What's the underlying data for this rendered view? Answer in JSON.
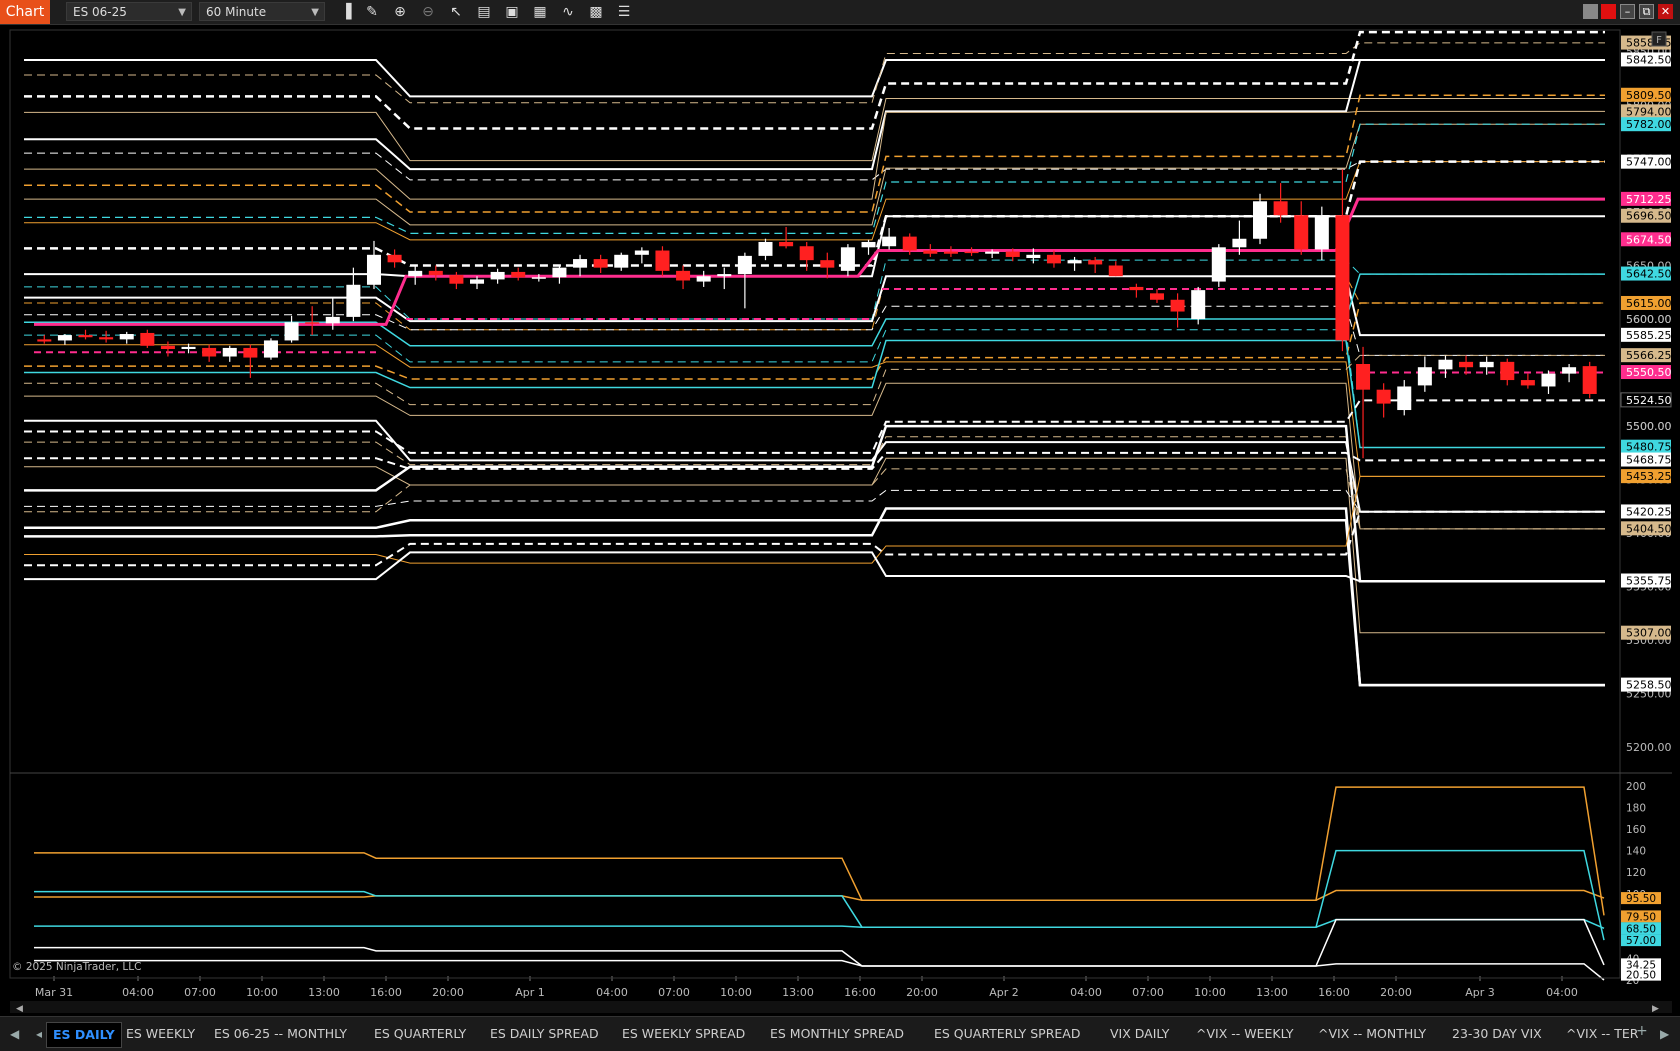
{
  "toolbar": {
    "window_label": "Chart",
    "instrument": "ES 06-25",
    "interval": "60 Minute",
    "icons": [
      "bar-type-icon",
      "draw-pencil-icon",
      "zoom-in-icon",
      "zoom-out-icon",
      "pointer-icon",
      "properties-icon",
      "data-box-icon",
      "templates-icon",
      "indicators-icon",
      "strategies-icon",
      "object-list-icon"
    ],
    "window_buttons": [
      "float-icon",
      "link-color-icon",
      "minimize-icon",
      "maximize-icon",
      "close-icon"
    ]
  },
  "panel_badge": "F",
  "copyright": "© 2025 NinjaTrader, LLC",
  "colors": {
    "bg": "#000000",
    "white": "#ffffff",
    "orange": "#f0a030",
    "tan": "#d6b98c",
    "cyan": "#3fd8e0",
    "magenta": "#ff2d8e",
    "up": "#ffffff",
    "down": "#ff2020",
    "accent": "#e8501a"
  },
  "chart_data": [
    {
      "type": "candlestick",
      "panel": "price",
      "ylim": [
        5175,
        5870
      ],
      "yticks": [
        "5200.00",
        "5250.00",
        "5300.00",
        "5350.00",
        "5400.00",
        "5450.00",
        "5500.00",
        "5550.00",
        "5600.00",
        "5650.00",
        "5700.00",
        "5750.00",
        "5800.00",
        "5850.00"
      ],
      "xticks": [
        "Mar 31",
        "04:00",
        "07:00",
        "10:00",
        "13:00",
        "16:00",
        "20:00",
        "Apr 1",
        "04:00",
        "07:00",
        "10:00",
        "13:00",
        "16:00",
        "20:00",
        "Apr 2",
        "04:00",
        "07:00",
        "10:00",
        "13:00",
        "16:00",
        "20:00",
        "Apr 3",
        "04:00"
      ],
      "sessions": [
        "Mar 31",
        "Apr 1",
        "Apr 2",
        "Apr 3"
      ],
      "price_tags": [
        {
          "label": "5858.25",
          "color": "tan"
        },
        {
          "label": "5842.50",
          "color": "white"
        },
        {
          "label": "5809.50",
          "color": "orange"
        },
        {
          "label": "5794.00",
          "color": "tan"
        },
        {
          "label": "5782.00",
          "color": "cyan"
        },
        {
          "label": "5747.00",
          "color": "white"
        },
        {
          "label": "5712.25",
          "color": "magenta"
        },
        {
          "label": "5696.50",
          "color": "tan"
        },
        {
          "label": "5674.50",
          "color": "magenta"
        },
        {
          "label": "5642.50",
          "color": "cyan"
        },
        {
          "label": "5615.00",
          "color": "orange"
        },
        {
          "label": "5600.00",
          "color": "tick"
        },
        {
          "label": "5585.25",
          "color": "white"
        },
        {
          "label": "5566.25",
          "color": "tan"
        },
        {
          "label": "5550.50",
          "color": "magenta"
        },
        {
          "label": "5524.50",
          "color": "black"
        },
        {
          "label": "5500.00",
          "color": "tick"
        },
        {
          "label": "5480.75",
          "color": "cyan"
        },
        {
          "label": "5468.75",
          "color": "white"
        },
        {
          "label": "5453.25",
          "color": "orange"
        },
        {
          "label": "5420.25",
          "color": "white"
        },
        {
          "label": "5404.50",
          "color": "tan"
        },
        {
          "label": "5355.75",
          "color": "white"
        },
        {
          "label": "5307.00",
          "color": "tan"
        },
        {
          "label": "5258.50",
          "color": "white"
        }
      ],
      "candles": [
        {
          "o": 5581,
          "h": 5585,
          "l": 5577,
          "c": 5579
        },
        {
          "o": 5580,
          "h": 5586,
          "l": 5576,
          "c": 5585
        },
        {
          "o": 5585,
          "h": 5590,
          "l": 5581,
          "c": 5583
        },
        {
          "o": 5583,
          "h": 5589,
          "l": 5578,
          "c": 5581
        },
        {
          "o": 5581,
          "h": 5588,
          "l": 5577,
          "c": 5586
        },
        {
          "o": 5587,
          "h": 5590,
          "l": 5573,
          "c": 5575
        },
        {
          "o": 5575,
          "h": 5579,
          "l": 5565,
          "c": 5572
        },
        {
          "o": 5572,
          "h": 5577,
          "l": 5568,
          "c": 5574
        },
        {
          "o": 5573,
          "h": 5576,
          "l": 5560,
          "c": 5565
        },
        {
          "o": 5565,
          "h": 5575,
          "l": 5560,
          "c": 5573
        },
        {
          "o": 5573,
          "h": 5576,
          "l": 5545,
          "c": 5564
        },
        {
          "o": 5564,
          "h": 5582,
          "l": 5562,
          "c": 5580
        },
        {
          "o": 5580,
          "h": 5603,
          "l": 5578,
          "c": 5597
        },
        {
          "o": 5597,
          "h": 5612,
          "l": 5585,
          "c": 5596
        },
        {
          "o": 5596,
          "h": 5620,
          "l": 5590,
          "c": 5602
        },
        {
          "o": 5602,
          "h": 5648,
          "l": 5598,
          "c": 5632
        },
        {
          "o": 5632,
          "h": 5673,
          "l": 5628,
          "c": 5660
        },
        {
          "o": 5660,
          "h": 5665,
          "l": 5648,
          "c": 5653
        },
        {
          "o": 5640,
          "h": 5650,
          "l": 5632,
          "c": 5645
        },
        {
          "o": 5645,
          "h": 5650,
          "l": 5636,
          "c": 5641
        },
        {
          "o": 5641,
          "h": 5644,
          "l": 5628,
          "c": 5633
        },
        {
          "o": 5633,
          "h": 5640,
          "l": 5628,
          "c": 5637
        },
        {
          "o": 5637,
          "h": 5647,
          "l": 5633,
          "c": 5644
        },
        {
          "o": 5644,
          "h": 5648,
          "l": 5636,
          "c": 5639
        },
        {
          "o": 5638,
          "h": 5642,
          "l": 5635,
          "c": 5639
        },
        {
          "o": 5639,
          "h": 5650,
          "l": 5633,
          "c": 5648
        },
        {
          "o": 5648,
          "h": 5660,
          "l": 5640,
          "c": 5656
        },
        {
          "o": 5656,
          "h": 5660,
          "l": 5643,
          "c": 5648
        },
        {
          "o": 5648,
          "h": 5662,
          "l": 5645,
          "c": 5660
        },
        {
          "o": 5660,
          "h": 5667,
          "l": 5652,
          "c": 5664
        },
        {
          "o": 5664,
          "h": 5668,
          "l": 5640,
          "c": 5645
        },
        {
          "o": 5645,
          "h": 5650,
          "l": 5628,
          "c": 5636
        },
        {
          "o": 5635,
          "h": 5645,
          "l": 5630,
          "c": 5640
        },
        {
          "o": 5640,
          "h": 5648,
          "l": 5628,
          "c": 5642
        },
        {
          "o": 5642,
          "h": 5662,
          "l": 5610,
          "c": 5659
        },
        {
          "o": 5659,
          "h": 5675,
          "l": 5655,
          "c": 5672
        },
        {
          "o": 5672,
          "h": 5686,
          "l": 5666,
          "c": 5668
        },
        {
          "o": 5668,
          "h": 5672,
          "l": 5645,
          "c": 5655
        },
        {
          "o": 5655,
          "h": 5662,
          "l": 5638,
          "c": 5648
        },
        {
          "o": 5645,
          "h": 5670,
          "l": 5640,
          "c": 5667
        },
        {
          "o": 5667,
          "h": 5674,
          "l": 5660,
          "c": 5672
        },
        {
          "o": 5668,
          "h": 5685,
          "l": 5665,
          "c": 5677
        },
        {
          "o": 5677,
          "h": 5680,
          "l": 5660,
          "c": 5664
        },
        {
          "o": 5664,
          "h": 5670,
          "l": 5658,
          "c": 5661
        },
        {
          "o": 5663,
          "h": 5668,
          "l": 5658,
          "c": 5661
        },
        {
          "o": 5663,
          "h": 5667,
          "l": 5659,
          "c": 5662
        },
        {
          "o": 5661,
          "h": 5665,
          "l": 5657,
          "c": 5663
        },
        {
          "o": 5663,
          "h": 5666,
          "l": 5654,
          "c": 5658
        },
        {
          "o": 5657,
          "h": 5666,
          "l": 5652,
          "c": 5660
        },
        {
          "o": 5660,
          "h": 5664,
          "l": 5648,
          "c": 5652
        },
        {
          "o": 5652,
          "h": 5658,
          "l": 5645,
          "c": 5655
        },
        {
          "o": 5655,
          "h": 5658,
          "l": 5643,
          "c": 5651
        },
        {
          "o": 5650,
          "h": 5654,
          "l": 5640,
          "c": 5640
        },
        {
          "o": 5630,
          "h": 5633,
          "l": 5620,
          "c": 5627
        },
        {
          "o": 5624,
          "h": 5628,
          "l": 5615,
          "c": 5618
        },
        {
          "o": 5618,
          "h": 5624,
          "l": 5592,
          "c": 5607
        },
        {
          "o": 5600,
          "h": 5630,
          "l": 5595,
          "c": 5627
        },
        {
          "o": 5635,
          "h": 5670,
          "l": 5630,
          "c": 5667
        },
        {
          "o": 5667,
          "h": 5692,
          "l": 5660,
          "c": 5675
        },
        {
          "o": 5675,
          "h": 5717,
          "l": 5670,
          "c": 5710
        },
        {
          "o": 5710,
          "h": 5727,
          "l": 5690,
          "c": 5697
        },
        {
          "o": 5697,
          "h": 5710,
          "l": 5660,
          "c": 5665
        },
        {
          "o": 5665,
          "h": 5705,
          "l": 5655,
          "c": 5697
        },
        {
          "o": 5697,
          "h": 5740,
          "l": 5570,
          "c": 5580
        },
        {
          "o": 5558,
          "h": 5574,
          "l": 5470,
          "c": 5534
        },
        {
          "o": 5534,
          "h": 5540,
          "l": 5508,
          "c": 5521
        },
        {
          "o": 5515,
          "h": 5543,
          "l": 5510,
          "c": 5537
        },
        {
          "o": 5538,
          "h": 5565,
          "l": 5532,
          "c": 5555
        },
        {
          "o": 5553,
          "h": 5566,
          "l": 5545,
          "c": 5562
        },
        {
          "o": 5560,
          "h": 5566,
          "l": 5548,
          "c": 5555
        },
        {
          "o": 5555,
          "h": 5565,
          "l": 5548,
          "c": 5560
        },
        {
          "o": 5560,
          "h": 5563,
          "l": 5538,
          "c": 5543
        },
        {
          "o": 5543,
          "h": 5549,
          "l": 5535,
          "c": 5538
        },
        {
          "o": 5537,
          "h": 5552,
          "l": 5530,
          "c": 5549
        },
        {
          "o": 5549,
          "h": 5558,
          "l": 5541,
          "c": 5555
        },
        {
          "o": 5556,
          "h": 5560,
          "l": 5526,
          "c": 5530
        }
      ]
    },
    {
      "type": "line",
      "panel": "indicator",
      "ylim": [
        20,
        200
      ],
      "yticks": [
        "20",
        "40",
        "60",
        "80",
        "100",
        "120",
        "140",
        "160",
        "180",
        "200"
      ],
      "value_tags": [
        {
          "label": "95.50",
          "color": "orange"
        },
        {
          "label": "79.50",
          "color": "orange"
        },
        {
          "label": "68.50",
          "color": "cyan"
        },
        {
          "label": "57.00",
          "color": "cyan"
        },
        {
          "label": "34.25",
          "color": "white"
        },
        {
          "label": "20.50",
          "color": "white"
        }
      ]
    }
  ],
  "bottom_tabs": [
    "ES DAILY",
    "ES WEEKLY",
    "ES 06-25 -- MONTHLY",
    "ES QUARTERLY",
    "ES DAILY SPREAD",
    "ES WEEKLY SPREAD",
    "ES MONTHLY SPREAD",
    "ES QUARTERLY SPREAD",
    "VIX DAILY",
    "^VIX -- WEEKLY",
    "^VIX -- MONTHLY",
    "23-30 DAY VIX",
    "^VIX -- TER"
  ],
  "active_tab": "ES DAILY"
}
